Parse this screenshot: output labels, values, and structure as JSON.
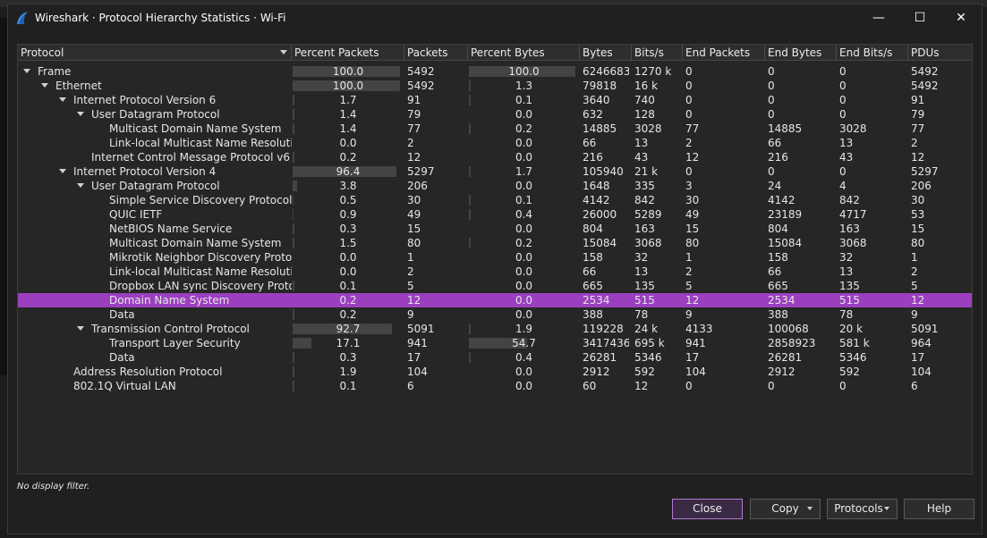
{
  "window": {
    "title": "Wireshark · Protocol Hierarchy Statistics · Wi-Fi",
    "minimize": "—",
    "maximize": "☐",
    "close": "✕"
  },
  "columns": [
    "Protocol",
    "Percent Packets",
    "Packets",
    "Percent Bytes",
    "Bytes",
    "Bits/s",
    "End Packets",
    "End Bytes",
    "End Bits/s",
    "PDUs"
  ],
  "rows": [
    {
      "level": 0,
      "expanded": true,
      "name": "Frame",
      "pct_packets": "100.0",
      "packets": "5492",
      "pct_bytes": "100.0",
      "bytes": "6246683",
      "bits": "1270 k",
      "end_packets": "0",
      "end_bytes": "0",
      "end_bits": "0",
      "pdus": "5492",
      "pp_frac": 1.0,
      "pb_frac": 1.0
    },
    {
      "level": 1,
      "expanded": true,
      "name": "Ethernet",
      "pct_packets": "100.0",
      "packets": "5492",
      "pct_bytes": "1.3",
      "bytes": "79818",
      "bits": "16 k",
      "end_packets": "0",
      "end_bytes": "0",
      "end_bits": "0",
      "pdus": "5492",
      "pp_frac": 1.0,
      "pb_frac": 0.013
    },
    {
      "level": 2,
      "expanded": true,
      "name": "Internet Protocol Version 6",
      "pct_packets": "1.7",
      "packets": "91",
      "pct_bytes": "0.1",
      "bytes": "3640",
      "bits": "740",
      "end_packets": "0",
      "end_bytes": "0",
      "end_bits": "0",
      "pdus": "91",
      "pp_frac": 0.017,
      "pb_frac": 0.001
    },
    {
      "level": 3,
      "expanded": true,
      "name": "User Datagram Protocol",
      "pct_packets": "1.4",
      "packets": "79",
      "pct_bytes": "0.0",
      "bytes": "632",
      "bits": "128",
      "end_packets": "0",
      "end_bytes": "0",
      "end_bits": "0",
      "pdus": "79",
      "pp_frac": 0.014,
      "pb_frac": 0.0
    },
    {
      "level": 4,
      "expanded": false,
      "name": "Multicast Domain Name System",
      "pct_packets": "1.4",
      "packets": "77",
      "pct_bytes": "0.2",
      "bytes": "14885",
      "bits": "3028",
      "end_packets": "77",
      "end_bytes": "14885",
      "end_bits": "3028",
      "pdus": "77",
      "pp_frac": 0.014,
      "pb_frac": 0.002
    },
    {
      "level": 4,
      "expanded": false,
      "name": "Link-local Multicast Name Resolution",
      "pct_packets": "0.0",
      "packets": "2",
      "pct_bytes": "0.0",
      "bytes": "66",
      "bits": "13",
      "end_packets": "2",
      "end_bytes": "66",
      "end_bits": "13",
      "pdus": "2",
      "pp_frac": 0.0,
      "pb_frac": 0.0
    },
    {
      "level": 3,
      "expanded": false,
      "name": "Internet Control Message Protocol v6",
      "pct_packets": "0.2",
      "packets": "12",
      "pct_bytes": "0.0",
      "bytes": "216",
      "bits": "43",
      "end_packets": "12",
      "end_bytes": "216",
      "end_bits": "43",
      "pdus": "12",
      "pp_frac": 0.002,
      "pb_frac": 0.0
    },
    {
      "level": 2,
      "expanded": true,
      "name": "Internet Protocol Version 4",
      "pct_packets": "96.4",
      "packets": "5297",
      "pct_bytes": "1.7",
      "bytes": "105940",
      "bits": "21 k",
      "end_packets": "0",
      "end_bytes": "0",
      "end_bits": "0",
      "pdus": "5297",
      "pp_frac": 0.964,
      "pb_frac": 0.017
    },
    {
      "level": 3,
      "expanded": true,
      "name": "User Datagram Protocol",
      "pct_packets": "3.8",
      "packets": "206",
      "pct_bytes": "0.0",
      "bytes": "1648",
      "bits": "335",
      "end_packets": "3",
      "end_bytes": "24",
      "end_bits": "4",
      "pdus": "206",
      "pp_frac": 0.038,
      "pb_frac": 0.0
    },
    {
      "level": 4,
      "expanded": false,
      "name": "Simple Service Discovery Protocol",
      "pct_packets": "0.5",
      "packets": "30",
      "pct_bytes": "0.1",
      "bytes": "4142",
      "bits": "842",
      "end_packets": "30",
      "end_bytes": "4142",
      "end_bits": "842",
      "pdus": "30",
      "pp_frac": 0.005,
      "pb_frac": 0.001
    },
    {
      "level": 4,
      "expanded": false,
      "name": "QUIC IETF",
      "pct_packets": "0.9",
      "packets": "49",
      "pct_bytes": "0.4",
      "bytes": "26000",
      "bits": "5289",
      "end_packets": "49",
      "end_bytes": "23189",
      "end_bits": "4717",
      "pdus": "53",
      "pp_frac": 0.009,
      "pb_frac": 0.004
    },
    {
      "level": 4,
      "expanded": false,
      "name": "NetBIOS Name Service",
      "pct_packets": "0.3",
      "packets": "15",
      "pct_bytes": "0.0",
      "bytes": "804",
      "bits": "163",
      "end_packets": "15",
      "end_bytes": "804",
      "end_bits": "163",
      "pdus": "15",
      "pp_frac": 0.003,
      "pb_frac": 0.0
    },
    {
      "level": 4,
      "expanded": false,
      "name": "Multicast Domain Name System",
      "pct_packets": "1.5",
      "packets": "80",
      "pct_bytes": "0.2",
      "bytes": "15084",
      "bits": "3068",
      "end_packets": "80",
      "end_bytes": "15084",
      "end_bits": "3068",
      "pdus": "80",
      "pp_frac": 0.015,
      "pb_frac": 0.002
    },
    {
      "level": 4,
      "expanded": false,
      "name": "Mikrotik Neighbor Discovery Protocol",
      "pct_packets": "0.0",
      "packets": "1",
      "pct_bytes": "0.0",
      "bytes": "158",
      "bits": "32",
      "end_packets": "1",
      "end_bytes": "158",
      "end_bits": "32",
      "pdus": "1",
      "pp_frac": 0.0,
      "pb_frac": 0.0
    },
    {
      "level": 4,
      "expanded": false,
      "name": "Link-local Multicast Name Resolution",
      "pct_packets": "0.0",
      "packets": "2",
      "pct_bytes": "0.0",
      "bytes": "66",
      "bits": "13",
      "end_packets": "2",
      "end_bytes": "66",
      "end_bits": "13",
      "pdus": "2",
      "pp_frac": 0.0,
      "pb_frac": 0.0
    },
    {
      "level": 4,
      "expanded": false,
      "name": "Dropbox LAN sync Discovery Protocol",
      "pct_packets": "0.1",
      "packets": "5",
      "pct_bytes": "0.0",
      "bytes": "665",
      "bits": "135",
      "end_packets": "5",
      "end_bytes": "665",
      "end_bits": "135",
      "pdus": "5",
      "pp_frac": 0.001,
      "pb_frac": 0.0
    },
    {
      "level": 4,
      "expanded": false,
      "name": "Domain Name System",
      "pct_packets": "0.2",
      "packets": "12",
      "pct_bytes": "0.0",
      "bytes": "2534",
      "bits": "515",
      "end_packets": "12",
      "end_bytes": "2534",
      "end_bits": "515",
      "pdus": "12",
      "pp_frac": 0.002,
      "pb_frac": 0.0,
      "selected": true
    },
    {
      "level": 4,
      "expanded": false,
      "name": "Data",
      "pct_packets": "0.2",
      "packets": "9",
      "pct_bytes": "0.0",
      "bytes": "388",
      "bits": "78",
      "end_packets": "9",
      "end_bytes": "388",
      "end_bits": "78",
      "pdus": "9",
      "pp_frac": 0.002,
      "pb_frac": 0.0
    },
    {
      "level": 3,
      "expanded": true,
      "name": "Transmission Control Protocol",
      "pct_packets": "92.7",
      "packets": "5091",
      "pct_bytes": "1.9",
      "bytes": "119228",
      "bits": "24 k",
      "end_packets": "4133",
      "end_bytes": "100068",
      "end_bits": "20 k",
      "pdus": "5091",
      "pp_frac": 0.927,
      "pb_frac": 0.019
    },
    {
      "level": 4,
      "expanded": false,
      "name": "Transport Layer Security",
      "pct_packets": "17.1",
      "packets": "941",
      "pct_bytes": "54.7",
      "bytes": "3417436",
      "bits": "695 k",
      "end_packets": "941",
      "end_bytes": "2858923",
      "end_bits": "581 k",
      "pdus": "964",
      "pp_frac": 0.171,
      "pb_frac": 0.547
    },
    {
      "level": 4,
      "expanded": false,
      "name": "Data",
      "pct_packets": "0.3",
      "packets": "17",
      "pct_bytes": "0.4",
      "bytes": "26281",
      "bits": "5346",
      "end_packets": "17",
      "end_bytes": "26281",
      "end_bits": "5346",
      "pdus": "17",
      "pp_frac": 0.003,
      "pb_frac": 0.004
    },
    {
      "level": 2,
      "expanded": false,
      "name": "Address Resolution Protocol",
      "pct_packets": "1.9",
      "packets": "104",
      "pct_bytes": "0.0",
      "bytes": "2912",
      "bits": "592",
      "end_packets": "104",
      "end_bytes": "2912",
      "end_bits": "592",
      "pdus": "104",
      "pp_frac": 0.019,
      "pb_frac": 0.0
    },
    {
      "level": 2,
      "expanded": false,
      "name": "802.1Q Virtual LAN",
      "pct_packets": "0.1",
      "packets": "6",
      "pct_bytes": "0.0",
      "bytes": "60",
      "bits": "12",
      "end_packets": "0",
      "end_bytes": "0",
      "end_bits": "0",
      "pdus": "6",
      "pp_frac": 0.001,
      "pb_frac": 0.0
    }
  ],
  "status": "No display filter.",
  "buttons": {
    "close": "Close",
    "copy": "Copy",
    "protocols": "Protocols",
    "help": "Help"
  },
  "colors": {
    "selection": "#9b3fbf",
    "accent_border": "#b07ad0"
  }
}
